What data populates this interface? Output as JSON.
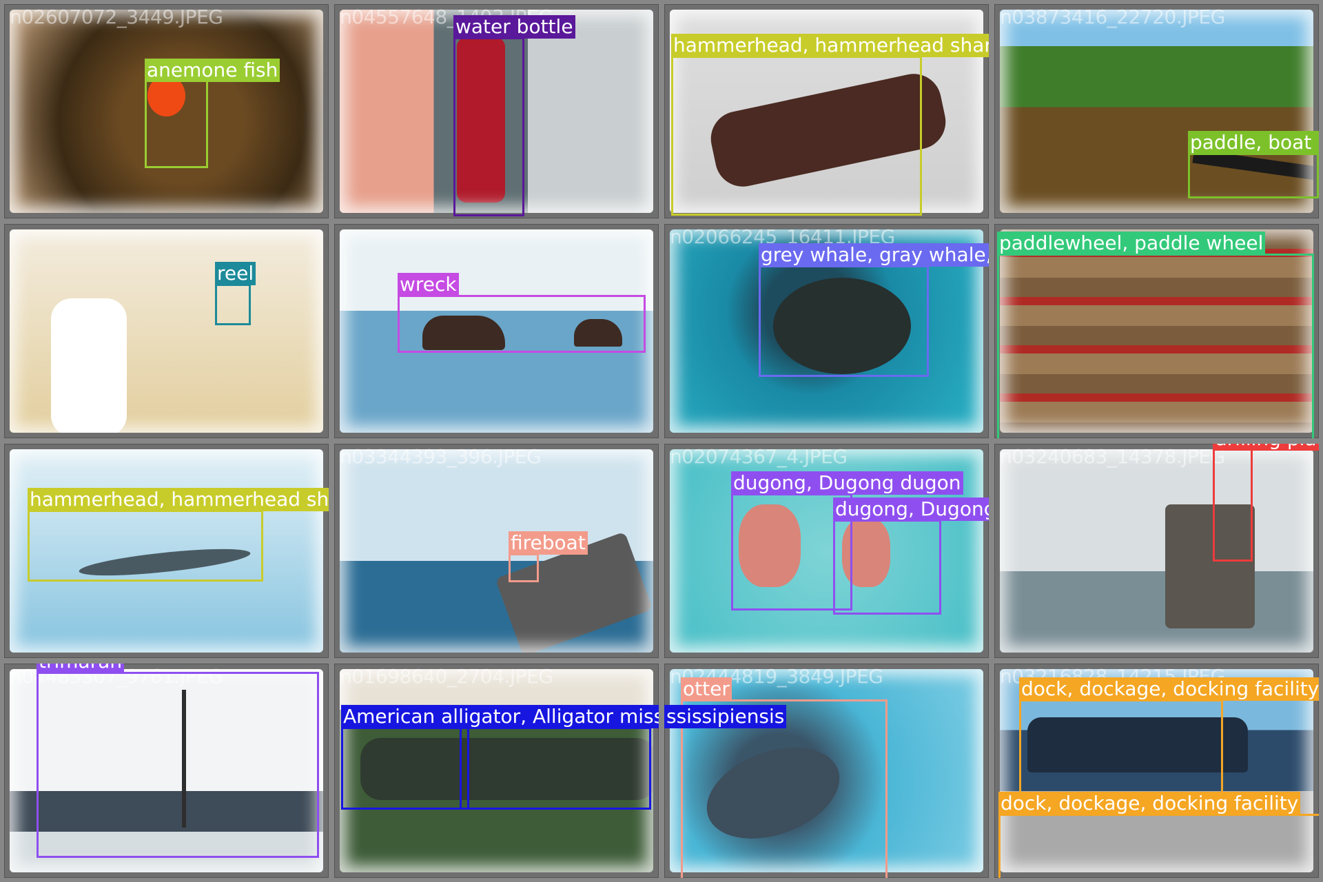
{
  "tiles": [
    {
      "file": "n02607072_3449.JPEG",
      "labels": [
        "anemone fish"
      ],
      "colors": [
        "#9acd32"
      ]
    },
    {
      "file": "n04557648_1493.JPEG",
      "labels": [
        "water bottle"
      ],
      "colors": [
        "#5a189a"
      ]
    },
    {
      "file": "",
      "labels": [
        "hammerhead, hammerhead shark"
      ],
      "colors": [
        "#c8cc2a"
      ]
    },
    {
      "file": "n03873416_22720.JPEG",
      "labels": [
        "paddle, boat p"
      ],
      "colors": [
        "#7cc12a"
      ]
    },
    {
      "file": "",
      "labels": [
        "reel"
      ],
      "colors": [
        "#1c8a9a"
      ]
    },
    {
      "file": "",
      "labels": [
        "wreck"
      ],
      "colors": [
        "#c54be3"
      ]
    },
    {
      "file": "n02066245_16411.JPEG",
      "labels": [
        "grey whale, gray whale, devilfish, Eschrichtius gibbosus, E"
      ],
      "colors": [
        "#6a6af0"
      ]
    },
    {
      "file": "",
      "labels": [
        "paddlewheel, paddle wheel"
      ],
      "colors": [
        "#33c97a"
      ]
    },
    {
      "file": "",
      "labels": [
        "hammerhead, hammerhead shark"
      ],
      "colors": [
        "#c8cc2a"
      ]
    },
    {
      "file": "n03344393_396.JPEG",
      "labels": [
        "fireboat"
      ],
      "colors": [
        "#f39b8b"
      ]
    },
    {
      "file": "n02074367_4.JPEG",
      "labels": [
        "dugong, Dugong dugon",
        "dugong, Dugong dugon"
      ],
      "colors": [
        "#8f4ff0",
        "#8f4ff0"
      ]
    },
    {
      "file": "n03240683_14378.JPEG",
      "labels": [
        "drilling platf"
      ],
      "colors": [
        "#ee3b3b"
      ]
    },
    {
      "file": "n04483307_9761.JPEG",
      "labels": [
        "trimaran"
      ],
      "colors": [
        "#8f4ff0"
      ]
    },
    {
      "file": "n01698640_2704.JPEG",
      "labels": [
        "American alligator, Alligator mississipiensis",
        "ssissipiensis"
      ],
      "colors": [
        "#1616e0",
        "#1616e0"
      ]
    },
    {
      "file": "n02444819_3849.JPEG",
      "labels": [
        "otter"
      ],
      "colors": [
        "#f39b8b"
      ]
    },
    {
      "file": "n03216828_14215.JPEG",
      "labels": [
        "dock, dockage, docking facility",
        "dock, dockage, docking facility"
      ],
      "colors": [
        "#f5a623",
        "#f5a623"
      ]
    }
  ]
}
